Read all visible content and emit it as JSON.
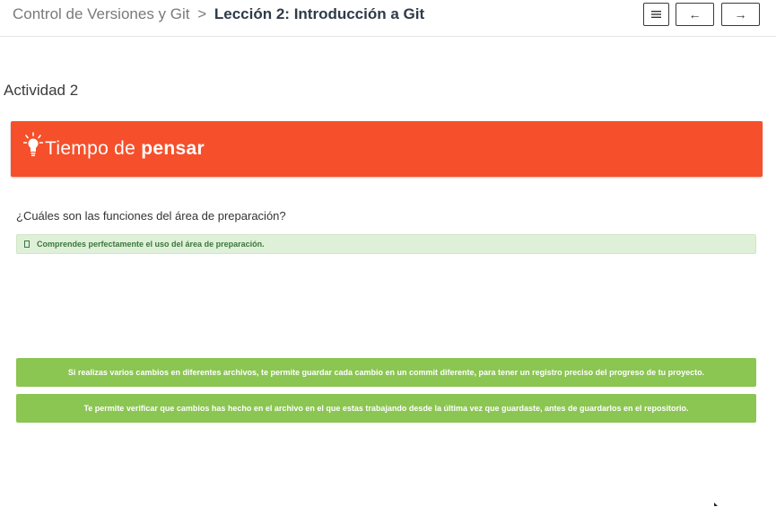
{
  "header": {
    "course": "Control de Versiones y Git",
    "separator": ">",
    "lesson": "Lección 2: Introducción a Git",
    "menu_icon": "hamburger-icon",
    "prev_label": "←",
    "next_label": "→"
  },
  "activity": {
    "title": "Actividad 2"
  },
  "banner": {
    "icon": "lightbulb-icon",
    "text_regular": "Tiempo de",
    "text_bold": "pensar",
    "color": "#f5502b"
  },
  "question": {
    "text": "¿Cuáles son las funciones del área de preparación?"
  },
  "feedback": {
    "icon": "checkbox-icon",
    "text": "Comprendes perfectamente el uso del área de preparación.",
    "color": "#3c763d",
    "background": "#dff0d8"
  },
  "options": [
    {
      "text": "Si realizas varios cambios en diferentes archivos, te permite guardar cada cambio en un commit diferente, para tener un registro preciso del progreso de tu proyecto."
    },
    {
      "text": "Te permite verificar que cambios has hecho en el archivo en el que estas trabajando desde la última vez que guardaste, antes de guardarlos en el repositorio."
    }
  ],
  "option_color": "#8bc552"
}
